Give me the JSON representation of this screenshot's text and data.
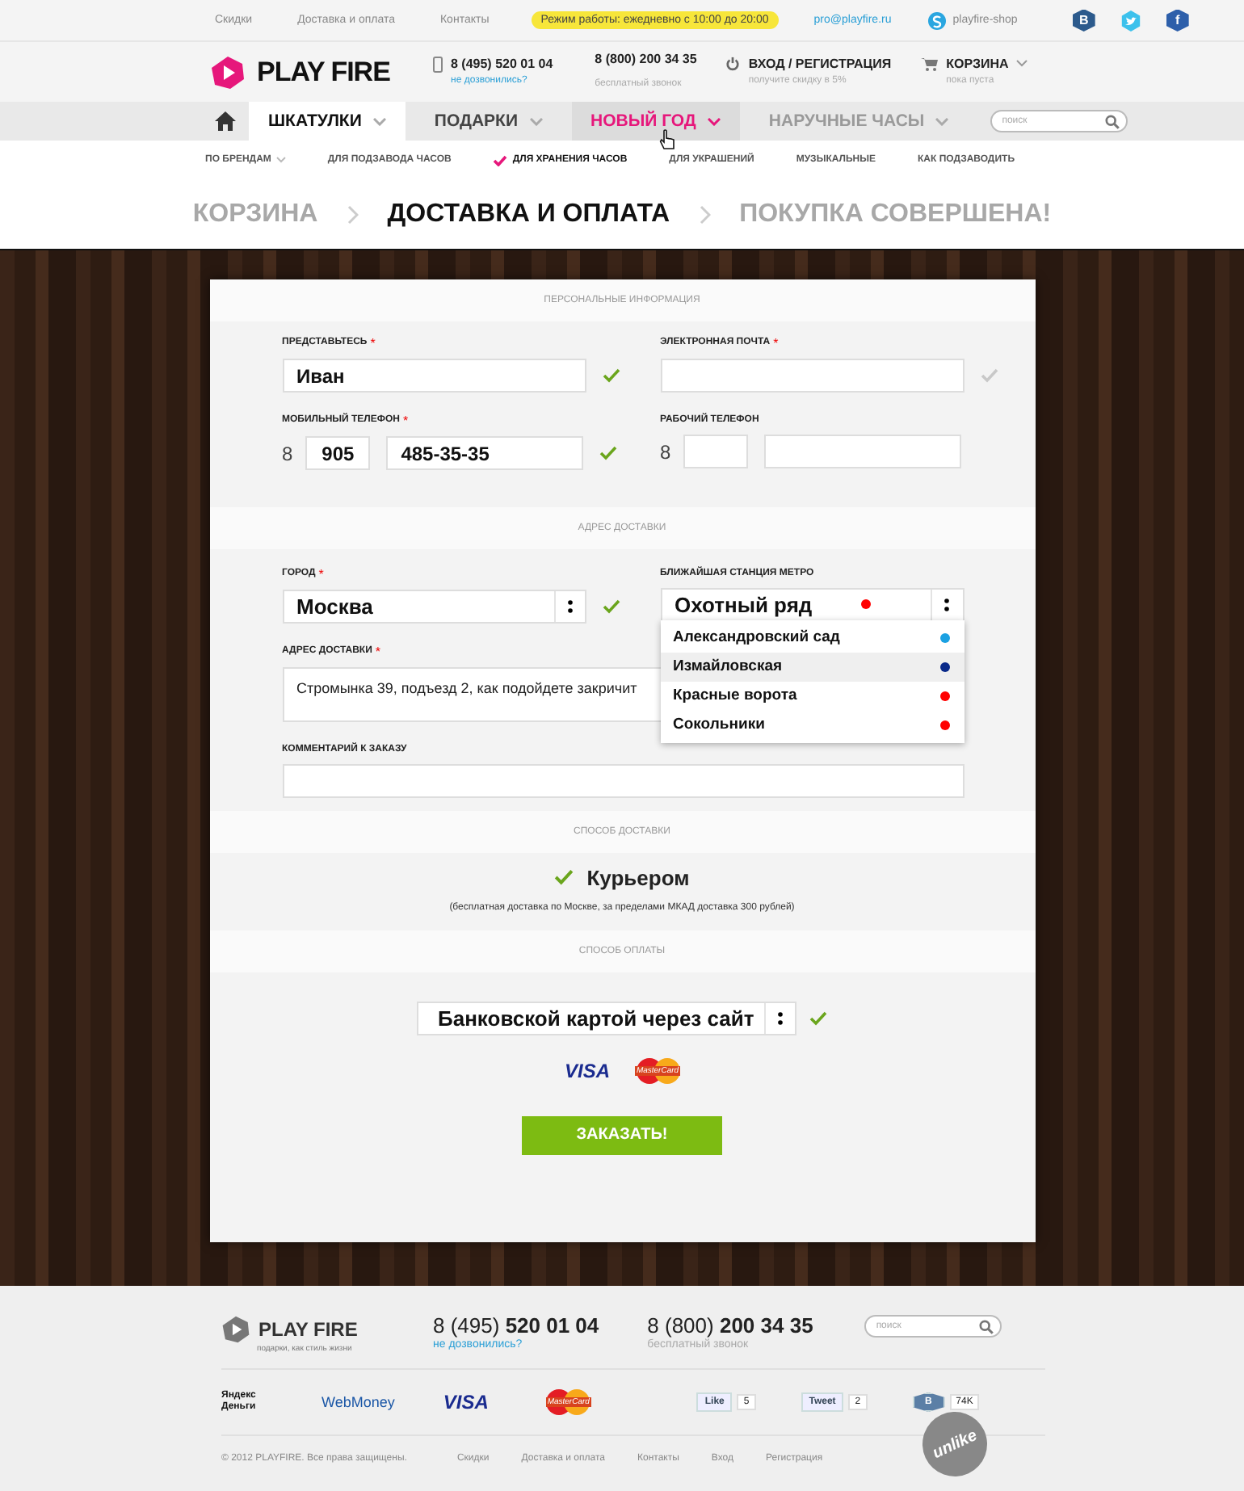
{
  "top_bar": {
    "links": [
      "Скидки",
      "Доставка и оплата",
      "Контакты"
    ],
    "hours": "Режим работы: ежедневно с 10:00 до 20:00",
    "email": "pro@playfire.ru",
    "skype": "playfire-shop",
    "social": [
      {
        "kind": "vk",
        "label": "В"
      },
      {
        "kind": "twitter"
      },
      {
        "kind": "facebook",
        "label": "f"
      }
    ]
  },
  "header": {
    "logo": "PLAY FIRE",
    "phone": {
      "number": "8 (495) 520 01 04",
      "link": "не дозвонились?"
    },
    "free_phone": {
      "number": "8 (800) 200 34 35",
      "note": "бесплатный звонок"
    },
    "login": {
      "label": "ВХОД / РЕГИСТРАЦИЯ",
      "note": "получите скидку в 5%"
    },
    "cart": {
      "label": "КОРЗИНА",
      "note": "пока пуста"
    }
  },
  "nav": {
    "items": [
      {
        "kind": "home",
        "selected": false,
        "highlighted": false,
        "disabled": false
      },
      {
        "kind": "menu",
        "label": "ШКАТУЛКИ",
        "selected": true,
        "highlighted": false,
        "disabled": false
      },
      {
        "kind": "menu",
        "label": "ПОДАРКИ",
        "selected": false,
        "highlighted": false,
        "disabled": false
      },
      {
        "kind": "menu",
        "label": "НОВЫЙ ГОД",
        "selected": false,
        "highlighted": true,
        "disabled": false
      },
      {
        "kind": "menu",
        "label": "НАРУЧНЫЕ ЧАСЫ",
        "selected": false,
        "highlighted": false,
        "disabled": true
      }
    ],
    "search": {
      "placeholder": "поиск"
    }
  },
  "subnav": [
    {
      "label": "ПО БРЕНДАМ",
      "dropdown": true,
      "selected": false
    },
    {
      "label": "ДЛЯ ПОДЗАВОДА ЧАСОВ",
      "dropdown": false,
      "selected": false
    },
    {
      "label": "ДЛЯ ХРАНЕНИЯ ЧАСОВ",
      "dropdown": false,
      "selected": true
    },
    {
      "label": "ДЛЯ УКРАШЕНИЙ",
      "dropdown": false,
      "selected": false
    },
    {
      "label": "МУЗЫКАЛЬНЫЕ",
      "dropdown": false,
      "selected": false
    },
    {
      "label": "КАК ПОДЗАВОДИТЬ",
      "dropdown": false,
      "selected": false
    }
  ],
  "steps": [
    {
      "label": "КОРЗИНА",
      "selected": false
    },
    {
      "label": "ДОСТАВКА И ОПЛАТА",
      "selected": true
    },
    {
      "label": "ПОКУПКА СОВЕРШЕНА!",
      "selected": false
    }
  ],
  "form": {
    "sections": [
      {
        "title": "ПЕРСОНАЛЬНЫЕ ИНФОРМАЦИЯ",
        "kind": "fields",
        "fields": [
          {
            "kind": "text",
            "label": "ПРЕДСТАВЬТЕСЬ",
            "required": "*",
            "value": "Иван",
            "valid": true
          },
          {
            "kind": "text",
            "label": "ЭЛЕКТРОННАЯ ПОЧТА",
            "required": "*",
            "valid": false
          },
          {
            "kind": "phone",
            "label": "МОБИЛЬНЫЙ ТЕЛЕФОН",
            "required": "*",
            "prefix": "8",
            "code": "905",
            "number": "485-35-35",
            "valid": true
          },
          {
            "kind": "phone",
            "label": "РАБОЧИЙ ТЕЛЕФОН",
            "prefix": "8"
          }
        ]
      },
      {
        "title": "АДРЕС ДОСТАВКИ",
        "kind": "fields",
        "fields": [
          {
            "kind": "select",
            "label": "ГОРОД",
            "required": "*",
            "value": "Москва",
            "valid": true
          },
          {
            "kind": "metro",
            "label": "БЛИЖАЙШАЯ СТАНЦИЯ МЕТРО",
            "value": "Охотный ряд",
            "color": "#ff0000",
            "expanded": true,
            "options": [
              {
                "label": "Александровский сад",
                "color": "#1ba1e2",
                "selected": false
              },
              {
                "label": "Измайловская",
                "color": "#0a2a8a",
                "selected": true
              },
              {
                "label": "Красные ворота",
                "color": "#ff0000",
                "selected": false
              },
              {
                "label": "Сокольники",
                "color": "#ff0000",
                "selected": false
              }
            ]
          },
          {
            "kind": "textarea",
            "label": "АДРЕС ДОСТАВКИ",
            "required": "*",
            "value": "Стромынка 39, подъезд 2, как подойдете закричит"
          },
          {
            "kind": "wide",
            "label": "КОММЕНТАРИЙ К ЗАКАЗУ"
          }
        ]
      },
      {
        "title": "СПОСОБ ДОСТАВКИ",
        "kind": "delivery",
        "option": "Курьером",
        "note": "(бесплатная доставка по Москве, за пределами МКАД доставка 300 рублей)"
      },
      {
        "title": "СПОСОБ ОПЛАТЫ",
        "kind": "payment",
        "value": "Банковской картой через сайт",
        "valid": true,
        "cards": [
          "VISA",
          "MasterCard"
        ],
        "button": "ЗАКАЗАТЬ!"
      }
    ]
  },
  "footer": {
    "logo": "PLAY FIRE",
    "tagline": "подарки, как стиль жизни",
    "phone": {
      "number": "8 (495) **520 01 04**",
      "link": "не дозвонились?"
    },
    "free_phone": {
      "number": "8 (800) **200 34 35**",
      "note": "бесплатный звонок"
    },
    "search": {
      "placeholder": "поиск"
    },
    "payments": [
      {
        "kind": "yandex",
        "label": "Яндекс Деньги"
      },
      {
        "kind": "webmoney",
        "label": "WebMoney"
      },
      {
        "kind": "visa",
        "label": "VISA"
      },
      {
        "kind": "mastercard",
        "label": "MasterCard"
      }
    ],
    "shares": [
      {
        "kind": "facebook",
        "label": "Like",
        "count": "5"
      },
      {
        "kind": "twitter",
        "label": "Tweet",
        "count": "2"
      },
      {
        "kind": "vk",
        "label": "В",
        "count": "74K"
      }
    ],
    "copyright": "© 2012 PLAYFIRE. Все права защищены.",
    "links": [
      "Скидки",
      "Доставка и оплата",
      "Контакты",
      "Вход",
      "Регистрация"
    ],
    "sticker": "unlike"
  }
}
